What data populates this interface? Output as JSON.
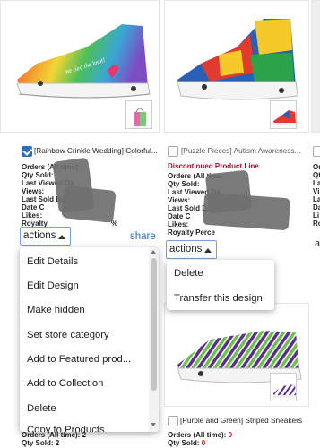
{
  "products": [
    {
      "title": "[Rainbow Crinkle Wedding] Colorful...",
      "checked": true,
      "shoe_text": "We tied the knot!",
      "stats": [
        "Orders (All time):",
        "Qty Sold:",
        "Last Viewed Da",
        "Views:",
        "Last Sold Da",
        "Date C",
        "Likes:",
        "Royalty"
      ],
      "stats_suffix": "%",
      "bottom_stats": [
        "Orders (All time): 2",
        "Qty Sold: 2"
      ],
      "actions_label": "actions",
      "share_label": "share"
    },
    {
      "title": "[Puzzle Pieces] Autism Awareness...",
      "checked": false,
      "discontinued_label": "Discontinued Product Line",
      "stats": [
        "Orders (All time",
        "Qty Sold:",
        "Last Viewed Da",
        "Views:",
        "Last Sold Da",
        "Date C",
        "Likes:",
        "Royalty Perce"
      ],
      "actions_label": "actions"
    },
    {
      "title": "[Purple and Green] Striped Sneakers",
      "checked": false,
      "bottom_stats": [
        "Orders (All time): 0",
        "Qty Sold: 0"
      ],
      "bottom_values": [
        "0",
        "0"
      ]
    },
    {
      "partial_stats": [
        "Or",
        "Qt",
        "La",
        "Vi",
        "La",
        "Da",
        "Li",
        "Ro"
      ],
      "actions_partial": "a"
    }
  ],
  "menu_left": {
    "items": [
      "Edit Details",
      "Edit Design",
      "Make hidden",
      "Set store category",
      "Add to Featured prod...",
      "Add to Collection",
      "Delete",
      "Copy to Products"
    ]
  },
  "menu_right": {
    "items": [
      "Delete",
      "Transfer this design"
    ]
  },
  "colors": {
    "accent": "#2d6cc0",
    "discontinued": "#b0082b",
    "zero_value": "#d11a1a"
  }
}
